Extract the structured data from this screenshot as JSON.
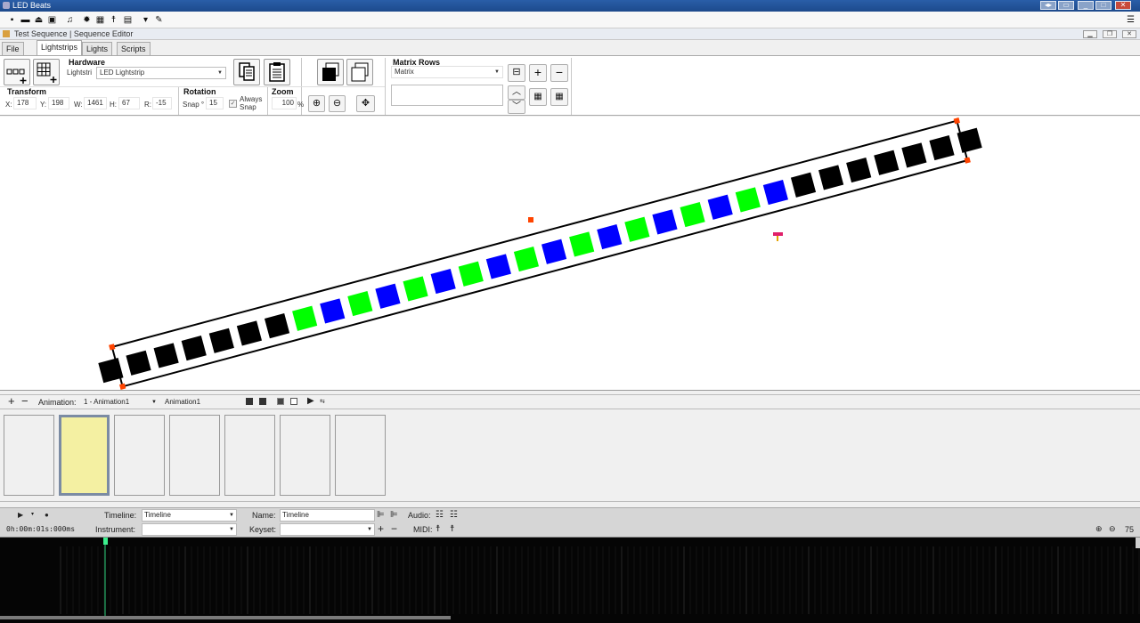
{
  "app": {
    "title": "LED Beats"
  },
  "window": {
    "title": "Test Sequence | Sequence Editor"
  },
  "tabs": [
    "File",
    "Lightstrips",
    "Lights",
    "Scripts"
  ],
  "ribbon": {
    "hardware_label": "Hardware",
    "hardware_type": "Lightstri",
    "hardware_value": "LED Lightstrip",
    "matrix_rows_label": "Matrix Rows",
    "matrix_value": "Matrix",
    "transform_label": "Transform",
    "x_label": "X:",
    "x_value": "178",
    "y_label": "Y:",
    "y_value": "198",
    "w_label": "W:",
    "w_value": "1461",
    "h_label": "H:",
    "h_value": "67",
    "r_label": "R:",
    "r_value": "-15",
    "rotation_label": "Rotation",
    "snap_label": "Snap °",
    "snap_value": "15",
    "always_snap_label": "Always Snap",
    "always_snap_checked": true,
    "zoom_label": "Zoom",
    "zoom_value": "100",
    "zoom_unit": "%"
  },
  "strip": {
    "leds": [
      "black",
      "black",
      "black",
      "black",
      "black",
      "black",
      "black",
      "green",
      "blue",
      "green",
      "blue",
      "green",
      "blue",
      "green",
      "blue",
      "green",
      "blue",
      "green",
      "blue",
      "green",
      "blue",
      "green",
      "blue",
      "green",
      "blue",
      "black",
      "black",
      "black",
      "black",
      "black",
      "black",
      "black"
    ],
    "colors": {
      "black": "#000000",
      "green": "#00ff00",
      "blue": "#0000ff",
      "handle": "#ff4400",
      "marker": "#e0206a"
    }
  },
  "animation": {
    "label": "Animation:",
    "selected": "1 - Animation1",
    "name": "Animation1",
    "frames": 7,
    "selected_frame": 1
  },
  "timeline": {
    "timeline_label": "Timeline:",
    "timeline_value": "Timeline",
    "name_label": "Name:",
    "name_value": "Timeline",
    "audio_label": "Audio:",
    "time_display": "0h:00m:01s:000ms",
    "instrument_label": "Instrument:",
    "keyset_label": "Keyset:",
    "midi_label": "MIDI:",
    "zoom_value": "75"
  }
}
